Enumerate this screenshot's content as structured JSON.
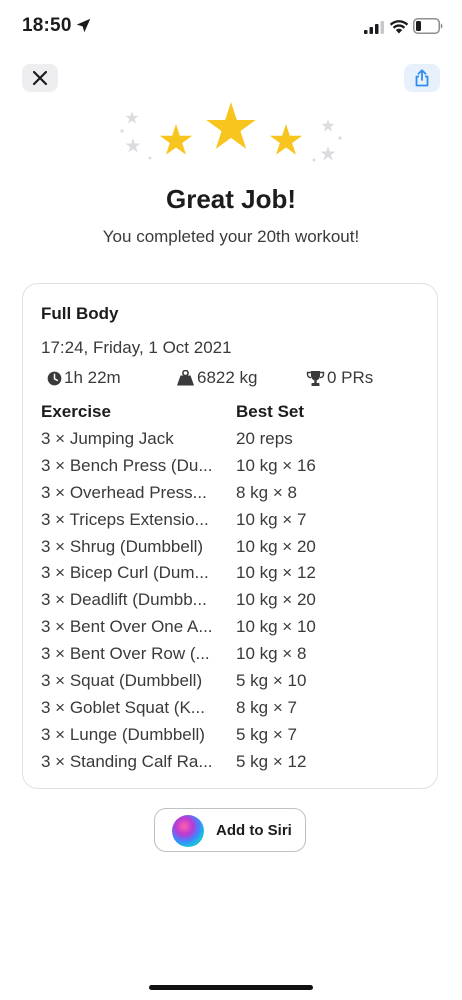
{
  "status_bar": {
    "time": "18:50"
  },
  "header": {
    "close_icon": "close-icon",
    "share_icon": "share-icon"
  },
  "rating": {
    "stars": 3,
    "color": "#F7C51E"
  },
  "headline": "Great Job!",
  "subline": "You completed your 20th workout!",
  "summary": {
    "name": "Full Body",
    "date": "17:24, Friday, 1 Oct 2021",
    "duration": "1h 22m",
    "volume": "6822 kg",
    "prs": "0 PRs",
    "columns": {
      "exercise": "Exercise",
      "best_set": "Best Set"
    },
    "exercises": [
      {
        "name": "3 × Jumping Jack",
        "best": "20 reps"
      },
      {
        "name": "3 × Bench Press (Du...",
        "best": "10 kg × 16"
      },
      {
        "name": "3 × Overhead Press...",
        "best": "8 kg × 8"
      },
      {
        "name": "3 × Triceps Extensio...",
        "best": "10 kg × 7"
      },
      {
        "name": "3 × Shrug (Dumbbell)",
        "best": "10 kg × 20"
      },
      {
        "name": "3 × Bicep Curl (Dum...",
        "best": "10 kg × 12"
      },
      {
        "name": "3 × Deadlift (Dumbb...",
        "best": "10 kg × 20"
      },
      {
        "name": "3 × Bent Over One A...",
        "best": "10 kg × 10"
      },
      {
        "name": "3 × Bent Over Row (...",
        "best": "10 kg × 8"
      },
      {
        "name": "3 × Squat (Dumbbell)",
        "best": "5 kg × 10"
      },
      {
        "name": "3 × Goblet Squat (K...",
        "best": "8 kg × 7"
      },
      {
        "name": "3 × Lunge (Dumbbell)",
        "best": "5 kg × 7"
      },
      {
        "name": "3 × Standing Calf Ra...",
        "best": "5 kg × 12"
      }
    ]
  },
  "siri": {
    "label": "Add to Siri"
  },
  "colors": {
    "accent": "#2F8CF0",
    "star": "#F7C51E",
    "muted_star": "#DCDCE0"
  }
}
